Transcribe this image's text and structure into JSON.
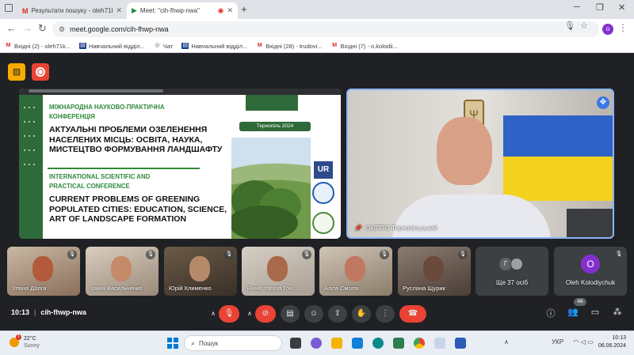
{
  "browser": {
    "tabs": [
      {
        "label": "Результати пошуку - oleh71ko...",
        "icon": "gmail-icon",
        "active": false
      },
      {
        "label": "Meet: \"cih-fhwp-nwa\"",
        "icon": "meet-icon",
        "active": true
      }
    ],
    "url": "meet.google.com/cih-fhwp-nwa",
    "profile_initial": "o",
    "bookmarks": [
      {
        "label": "Вхідні (2) - oleh71k...",
        "icon": "gmail-icon"
      },
      {
        "label": "Навчальний відділ...",
        "icon": "doc-icon"
      },
      {
        "label": "Чат",
        "icon": "chat-icon"
      },
      {
        "label": "Навчальний відділ...",
        "icon": "doc-icon"
      },
      {
        "label": "Вхідні (28) - trudovi...",
        "icon": "gmail-icon"
      },
      {
        "label": "Вхідні (7) - o.kolodii...",
        "icon": "gmail-icon"
      }
    ]
  },
  "slide": {
    "conf_ua": "МІЖНАРОДНА НАУКОВО-ПРАКТИЧНА КОНФЕРЕНЦІЯ",
    "title_ua": "АКТУАЛЬНІ ПРОБЛЕМИ ОЗЕЛЕНЕННЯ НАСЕЛЕНИХ МІСЦЬ: ОСВІТА, НАУКА, МИСТЕЦТВО ФОРМУВАННЯ ЛАНДШАФТУ",
    "conf_en": "INTERNATIONAL SCIENTIFIC AND PRACTICAL CONFERENCE",
    "title_en": "CURRENT PROBLEMS OF GREENING POPULATED CITIES: EDUCATION, SCIENCE, ART OF LANDSCAPE FORMATION",
    "city_badge": "Тернопіль 2024"
  },
  "speaker": {
    "name": "ОКІППО Тернопільський"
  },
  "participants": [
    {
      "name": "Уляна Долга"
    },
    {
      "name": "Ірина Васильченко"
    },
    {
      "name": "Юрій Клименко"
    },
    {
      "name": "Яніна Yanina Гон..."
    },
    {
      "name": "Алла Смоля"
    },
    {
      "name": "Руслана Щурик"
    }
  ],
  "more_tile": {
    "label": "Ще 37 осіб",
    "initial": "Г"
  },
  "oleh_tile": {
    "name": "Oleh Kolodiychuk",
    "initial": "O"
  },
  "controls": {
    "time": "10:13",
    "code": "cih-fhwp-nwa",
    "people_count": "46"
  },
  "taskbar": {
    "temp": "22°C",
    "condition": "Sunny",
    "search_placeholder": "Пошук",
    "lang": "УКР",
    "time": "10:13",
    "date": "06.06.2024",
    "weather_alert": "1"
  },
  "colors": {
    "accent_blue": "#8ab4f8",
    "red": "#ea4335",
    "meet_bg": "#202124",
    "slide_green": "#2f6b3a"
  }
}
